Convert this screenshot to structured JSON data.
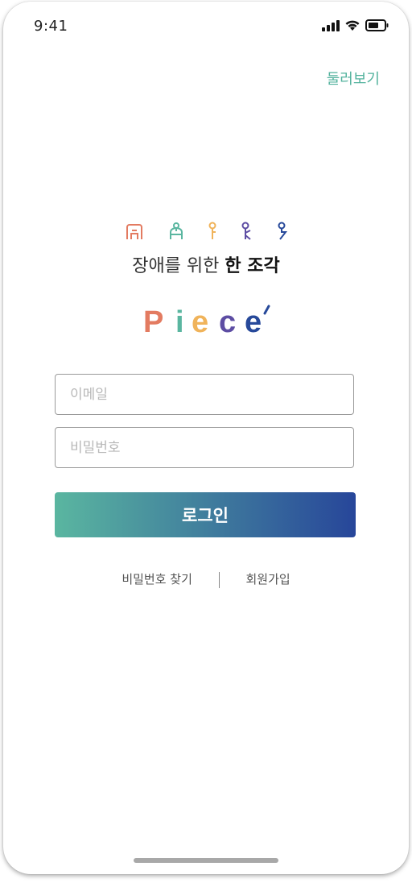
{
  "status_bar": {
    "time": "9:41"
  },
  "header": {
    "browse_label": "둘러보기"
  },
  "brand": {
    "tagline_regular": "장애를 위한",
    "tagline_bold": "한 조각",
    "logo_letters": [
      "P",
      "i",
      "e",
      "c",
      "e"
    ],
    "logo_colors": [
      "#e37b61",
      "#5ab6a0",
      "#f0b35a",
      "#5d4da3",
      "#27499a"
    ],
    "figure_icons": [
      "wheelchair-icon",
      "crutches-icon",
      "cane-person-icon",
      "walker-person-icon",
      "signing-person-icon"
    ]
  },
  "form": {
    "email_placeholder": "이메일",
    "password_placeholder": "비밀번호",
    "login_label": "로그인"
  },
  "footer_links": {
    "find_password": "비밀번호 찾기",
    "signup": "회원가입"
  },
  "colors": {
    "accent": "#52b29d",
    "gradient_start": "#5ab6a0",
    "gradient_end": "#27469a"
  }
}
